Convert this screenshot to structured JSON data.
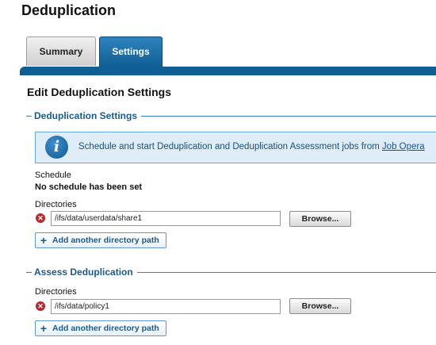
{
  "page": {
    "title": "Deduplication"
  },
  "tabs": [
    {
      "label": "Summary",
      "active": false
    },
    {
      "label": "Settings",
      "active": true
    }
  ],
  "main": {
    "heading": "Edit Deduplication Settings",
    "dedup_settings": {
      "legend": "Deduplication Settings",
      "info": {
        "icon": "info-icon",
        "text": "Schedule and start Deduplication and Deduplication Assessment jobs from ",
        "link": "Job Opera"
      },
      "schedule": {
        "label": "Schedule",
        "value": "No schedule has been set"
      },
      "directories": {
        "label": "Directories",
        "paths": [
          "/ifs/data/userdata/share1"
        ],
        "browse_label": "Browse...",
        "add_label": "Add another directory path"
      }
    },
    "assess": {
      "legend": "Assess Deduplication",
      "directories": {
        "label": "Directories",
        "paths": [
          "/ifs/data/policy1"
        ],
        "browse_label": "Browse...",
        "add_label": "Add another directory path"
      }
    }
  },
  "colors": {
    "accent": "#0f5e94",
    "legend": "#1b5a8c",
    "info_bg": "#deedf8",
    "remove": "#b8272b"
  }
}
